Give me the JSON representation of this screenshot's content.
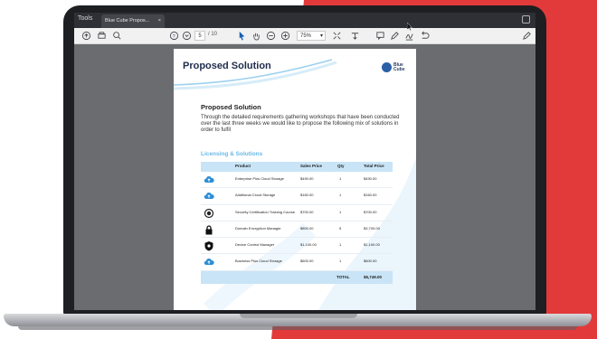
{
  "viewer": {
    "tools_label": "Tools",
    "tab_title": "Blue Cube Propos...",
    "tab_close": "×",
    "page_current": "5",
    "page_total": "/ 10",
    "zoom": "75%"
  },
  "document": {
    "title": "Proposed Solution",
    "logo_text": "Blue Cube",
    "section_heading": "Proposed Solution",
    "section_body": "Through the detailed requirements gathering workshops that have been conducted over the last three weeks we would like to propose the following mix of solutions in order to fulfil",
    "licensing_title": "Licensing & Solutions",
    "table": {
      "headers": [
        "Product",
        "Sales Price",
        "Qty",
        "Total Price"
      ],
      "rows": [
        {
          "icon": "cloud-icon",
          "product": "Enterprise Plus Cloud Storage",
          "price": "$490.00",
          "qty": "1",
          "total": "$490.00"
        },
        {
          "icon": "cloud-icon",
          "product": "Additional Cloud Storage",
          "price": "$160.00",
          "qty": "1",
          "total": "$160.00"
        },
        {
          "icon": "certificate-icon",
          "product": "Security Certification Training Course",
          "price": "$700.00",
          "qty": "1",
          "total": "$700.00"
        },
        {
          "icon": "lock-icon",
          "product": "Domain Encryption Manager",
          "price": "$800.00",
          "qty": "5",
          "total": "$3,700.00"
        },
        {
          "icon": "shield-icon",
          "product": "Device Control Manager",
          "price": "$1,100.00",
          "qty": "1",
          "total": "$1,100.00"
        },
        {
          "icon": "cloud-icon",
          "product": "Business Plus Cloud Storage",
          "price": "$600.00",
          "qty": "1",
          "total": "$600.00"
        }
      ],
      "total_label": "TOTAL",
      "total_value": "$6,749.00"
    }
  },
  "colors": {
    "accent_red": "#e23a3a",
    "table_header": "#c8e4f6",
    "icon_blue": "#2d8fd5"
  }
}
